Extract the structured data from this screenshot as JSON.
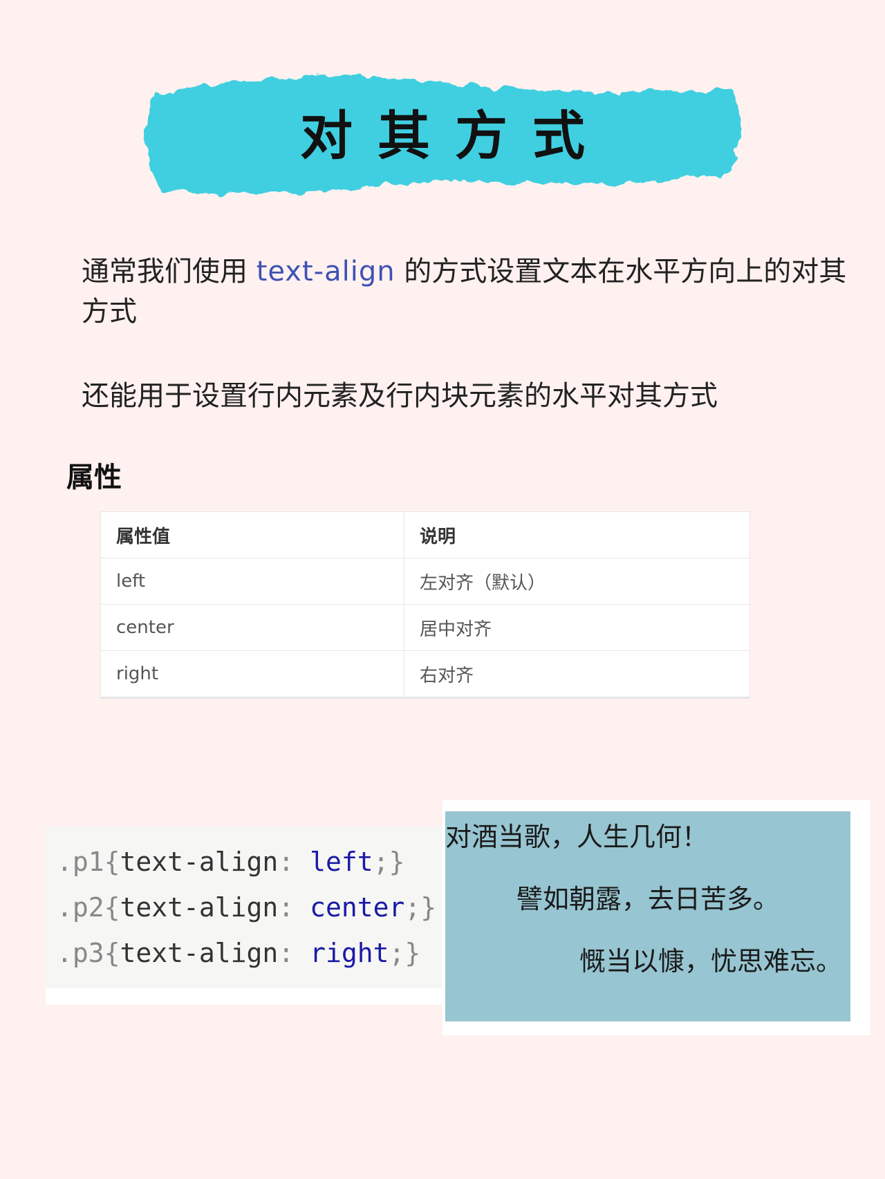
{
  "title": "对其方式",
  "intro": {
    "before": "通常我们使用 ",
    "code": "text-align",
    "after": " 的方式设置文本在水平方向上的对其方式"
  },
  "intro2": "还能用于设置行内元素及行内块元素的水平对其方式",
  "section_heading": "属性",
  "table": {
    "headers": [
      "属性值",
      "说明"
    ],
    "rows": [
      [
        "left",
        "左对齐（默认）"
      ],
      [
        "center",
        "居中对齐"
      ],
      [
        "right",
        "右对齐"
      ]
    ]
  },
  "code": {
    "lines": [
      {
        "selector": ".p1",
        "open": "{",
        "prop": "text-align",
        "colon": ": ",
        "value": "left",
        "close": ";}"
      },
      {
        "selector": ".p2",
        "open": "{",
        "prop": "text-align",
        "colon": ": ",
        "value": "center",
        "close": ";}"
      },
      {
        "selector": ".p3",
        "open": "{",
        "prop": "text-align",
        "colon": ": ",
        "value": "right",
        "close": ";}"
      }
    ]
  },
  "poem": {
    "lines": [
      "对酒当歌，人生几何！",
      "譬如朝露，去日苦多。",
      "慨当以慷，忧思难忘。"
    ]
  },
  "colors": {
    "background": "#fef1ef",
    "banner": "#3fcfe0",
    "inline_code": "#3f51b5",
    "poem_box": "#97c5d1"
  }
}
